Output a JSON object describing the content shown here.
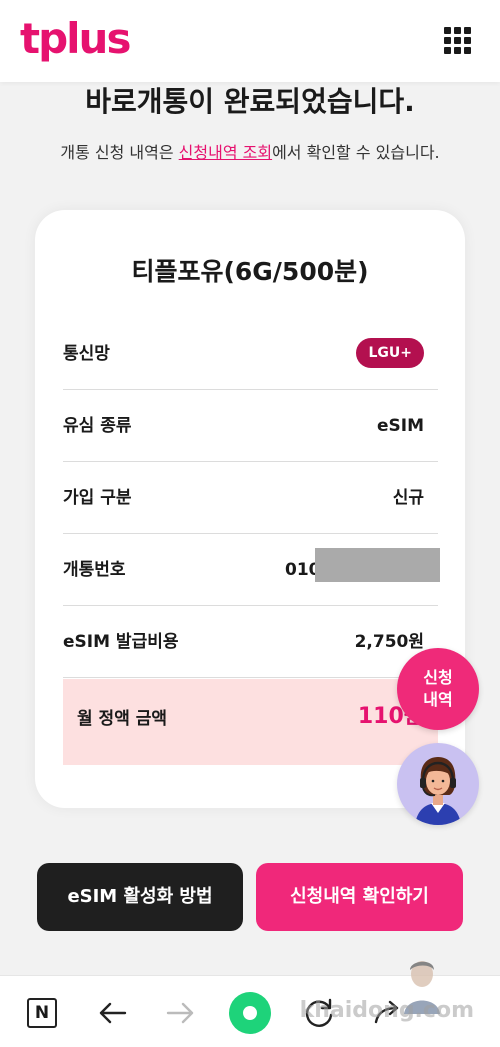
{
  "header": {
    "logo_text": "tplus",
    "menu_icon": "grid-menu-icon"
  },
  "main": {
    "title": "바로개통이 완료되었습니다.",
    "subtitle_before": "개통 신청 내역은 ",
    "subtitle_link": "신청내역 조회",
    "subtitle_after": "에서 확인할 수 있습니다."
  },
  "card": {
    "plan_name": "티플포유(6G/500분)",
    "rows": [
      {
        "label": "통신망",
        "value": "LGU+"
      },
      {
        "label": "유심 종류",
        "value": "eSIM"
      },
      {
        "label": "가입 구분",
        "value": "신규"
      },
      {
        "label": "개통번호",
        "value": "010"
      },
      {
        "label": "eSIM 발급비용",
        "value": "2,750원"
      },
      {
        "label": "월 정액 금액",
        "value": "110원"
      }
    ]
  },
  "floating": {
    "history_line1": "신청",
    "history_line2": "내역"
  },
  "actions": {
    "esim_guide": "eSIM 활성화 방법",
    "confirm_history": "신청내역 확인하기"
  },
  "navbar": {
    "n_label": "N",
    "watermark": "khaidong.com"
  },
  "colors": {
    "brand": "#e6126f",
    "badge": "#b3104f",
    "highlight_bg": "#fde0e0",
    "dark_button": "#1f1f1f",
    "pink_button": "#f0287a",
    "home": "#1ed37a"
  }
}
